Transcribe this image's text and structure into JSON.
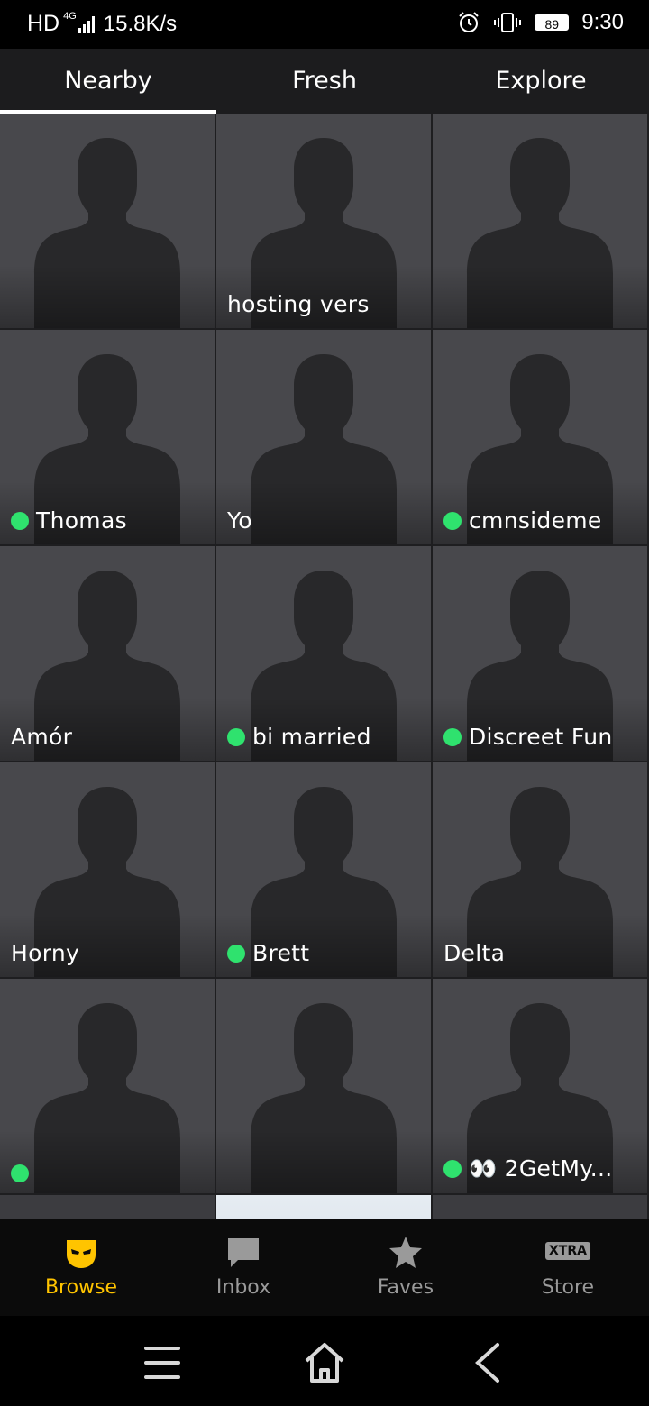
{
  "status_bar": {
    "left_hd": "HD",
    "network": "4G",
    "speed": "15.8K/s",
    "battery": "89",
    "time": "9:30"
  },
  "tabs": [
    {
      "label": "Nearby",
      "active": true
    },
    {
      "label": "Fresh",
      "active": false
    },
    {
      "label": "Explore",
      "active": false
    }
  ],
  "profiles": [
    {
      "name": "",
      "online": false
    },
    {
      "name": "hosting vers",
      "online": false
    },
    {
      "name": "",
      "online": false
    },
    {
      "name": "Thomas",
      "online": true
    },
    {
      "name": "Yo",
      "online": false
    },
    {
      "name": "cmnsideme",
      "online": true
    },
    {
      "name": "Amór",
      "online": false
    },
    {
      "name": "bi married",
      "online": true
    },
    {
      "name": "Discreet Fun",
      "online": true
    },
    {
      "name": "Horny",
      "online": false
    },
    {
      "name": "Brett",
      "online": true
    },
    {
      "name": "Delta",
      "online": false
    },
    {
      "name": "",
      "online": true
    },
    {
      "name": "",
      "online": false
    },
    {
      "name": "👀 2GetMy...",
      "online": true
    }
  ],
  "bottom_nav": [
    {
      "label": "Browse",
      "icon": "browse-mask-icon",
      "active": true
    },
    {
      "label": "Inbox",
      "icon": "chat-bubble-icon",
      "active": false
    },
    {
      "label": "Faves",
      "icon": "star-icon",
      "active": false
    },
    {
      "label": "Store",
      "icon": "xtra-badge-icon",
      "badge": "XTRA",
      "active": false
    }
  ],
  "colors": {
    "accent": "#ffc400",
    "online": "#2fe26e",
    "tile": "#48484c",
    "silhouette": "#28282a"
  }
}
